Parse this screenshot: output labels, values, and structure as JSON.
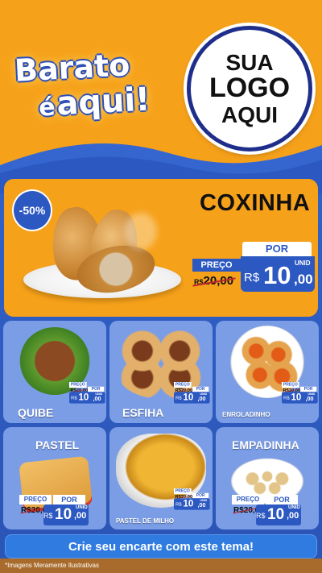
{
  "brand": {
    "line1": "Barato",
    "line2_prefix": "é",
    "line2_main": "aqui!"
  },
  "logo": {
    "line1": "SUA",
    "line2": "LOGO",
    "line3": "AQUI"
  },
  "featured": {
    "name": "COXINHA",
    "discount": "-50%",
    "price": {
      "preco_label": "PREÇO",
      "old_currency": "R$",
      "old_value": "20,00",
      "por_label": "POR",
      "unid_label": "UNID",
      "currency": "R$",
      "integer": "10",
      "decimal": ",00"
    }
  },
  "products": [
    {
      "name": "QUIBE",
      "preco_label": "PREÇO",
      "old_value": "R$20,00",
      "por_label": "POR",
      "currency": "R$",
      "integer": "10",
      "decimal": ",00",
      "unid_label": "UNID"
    },
    {
      "name": "ESFIHA",
      "preco_label": "PREÇO",
      "old_value": "R$20,00",
      "por_label": "POR",
      "currency": "R$",
      "integer": "10",
      "decimal": ",00",
      "unid_label": "UNID"
    },
    {
      "name": "ENROLADINHO",
      "preco_label": "PREÇO",
      "old_value": "R$20,00",
      "por_label": "POR",
      "currency": "R$",
      "integer": "10",
      "decimal": ",00",
      "unid_label": "UNID"
    },
    {
      "name": "PASTEL",
      "preco_label": "PREÇO",
      "old_value": "R$20,00",
      "por_label": "POR",
      "currency": "R$",
      "integer": "10",
      "decimal": ",00",
      "unid_label": "UNID"
    },
    {
      "name": "PASTEL DE MILHO",
      "preco_label": "PREÇO",
      "old_value": "R$20,00",
      "por_label": "POR",
      "currency": "R$",
      "integer": "10",
      "decimal": ",00",
      "unid_label": "UNID"
    },
    {
      "name": "EMPADINHA",
      "preco_label": "PREÇO",
      "old_value": "R$20,00",
      "por_label": "POR",
      "currency": "R$",
      "integer": "10",
      "decimal": ",00",
      "unid_label": "UNID"
    }
  ],
  "cta": "Crie seu encarte com este tema!",
  "disclaimer": "*Imagens Meramente Ilustrativas",
  "colors": {
    "orange": "#f6a11a",
    "blue": "#2c58c2",
    "card_blue": "#7b9de6",
    "navy": "#1f2e8a"
  }
}
